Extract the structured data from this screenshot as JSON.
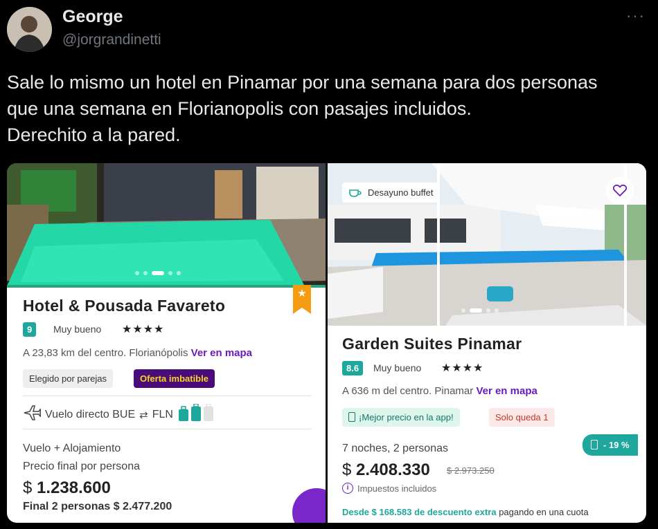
{
  "tweet": {
    "author_name": "George",
    "author_handle": "@jorgrandinetti",
    "more_icon": "more-icon",
    "text_lines": [
      "Sale lo mismo un hotel en Pinamar por una semana para dos personas",
      "que una semana en Florianopolis con pasajes incluidos.",
      "Derechito a la pared."
    ]
  },
  "card1": {
    "title": "Hotel & Pousada Favareto",
    "score": "9",
    "score_label": "Muy bueno",
    "stars": "★★★★",
    "distance": "A 23,83 km del centro. Florianópolis",
    "map_link": "Ver en mapa",
    "chips": [
      "Elegido por parejas",
      "Oferta imbatible"
    ],
    "flight": "Vuelo directo BUE",
    "flight_dest": "FLN",
    "package_label": "Vuelo + Alojamiento",
    "price_label": "Precio final por persona",
    "currency": "$",
    "price": "1.238.600",
    "total_label": "Final 2 personas $ 2.477.200",
    "colors": {
      "score": "#1ea79c",
      "chip_purple": "#4a0c79",
      "chip_yellow_text": "#f9d31f",
      "bookmark": "#f39c12"
    }
  },
  "card2": {
    "overlay_badge": "Desayuno buffet",
    "title": "Garden Suites Pinamar",
    "score": "8.6",
    "score_label": "Muy bueno",
    "stars": "★★★★",
    "distance": "A 636 m del centro. Pinamar",
    "map_link": "Ver en mapa",
    "chips": [
      "¡Mejor precio en la app!",
      "Solo queda 1"
    ],
    "discount_pill": "- 19 %",
    "stay_label": "7 noches, 2 personas",
    "currency": "$",
    "price": "2.408.330",
    "old_price": "$ 2.973.250",
    "taxes_label": "Impuestos incluidos",
    "promo_green": "Desde $ 168.583 de descuento extra",
    "promo_rest": "pagando en una cuota",
    "colors": {
      "score": "#1ea79c",
      "chip_green_bg": "#def5ec",
      "chip_red_bg": "#fde8e8"
    }
  }
}
